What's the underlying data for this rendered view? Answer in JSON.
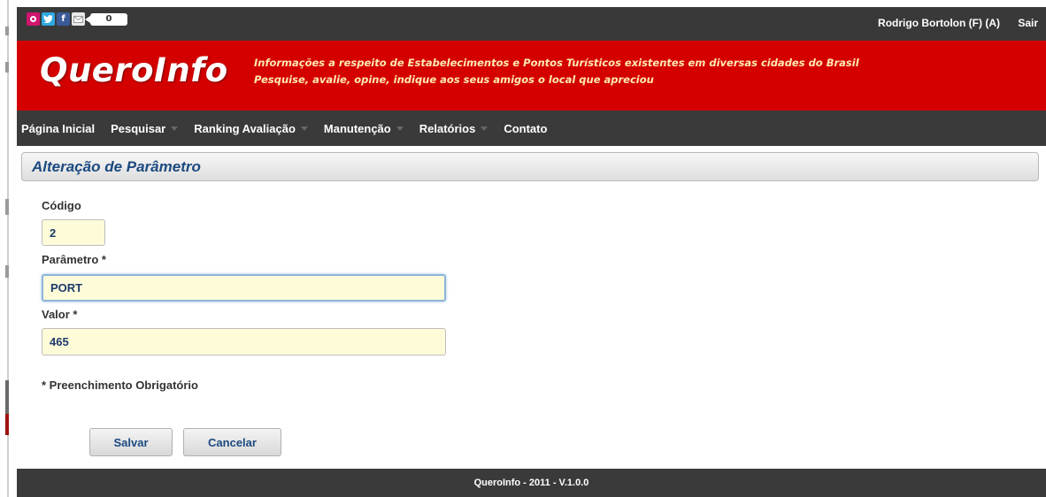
{
  "topbar": {
    "social_icons": [
      "orkut-icon",
      "twitter-icon",
      "facebook-icon",
      "mail-icon"
    ],
    "share_count": "0",
    "user": "Rodrigo Bortolon (F) (A)",
    "logout": "Sair"
  },
  "banner": {
    "logo": "QueroInfo",
    "tagline_line1": "Informações a respeito de Estabelecimentos e Pontos Turísticos existentes em diversas cidades do Brasil",
    "tagline_line2": "Pesquise, avalie, opine, indique aos seus amigos o local que apreciou"
  },
  "menu": {
    "items": [
      {
        "label": "Página Inicial",
        "dropdown": false
      },
      {
        "label": "Pesquisar",
        "dropdown": true
      },
      {
        "label": "Ranking Avaliação",
        "dropdown": true
      },
      {
        "label": "Manutenção",
        "dropdown": true
      },
      {
        "label": "Relatórios",
        "dropdown": true
      },
      {
        "label": "Contato",
        "dropdown": false
      }
    ]
  },
  "page": {
    "title": "Alteração de Parâmetro"
  },
  "form": {
    "codigo_label": "Código",
    "codigo_value": "2",
    "parametro_label": "Parâmetro *",
    "parametro_value": "PORT",
    "valor_label": "Valor *",
    "valor_value": "465",
    "required_note": "* Preenchimento Obrigatório",
    "save_label": "Salvar",
    "cancel_label": "Cancelar"
  },
  "footer": {
    "text": "QueroInfo - 2011 - V.1.0.0"
  },
  "colors": {
    "banner": "#d40000",
    "bars": "#3a3a3a",
    "title": "#1c4a80",
    "field_bg": "#fefbd9"
  }
}
